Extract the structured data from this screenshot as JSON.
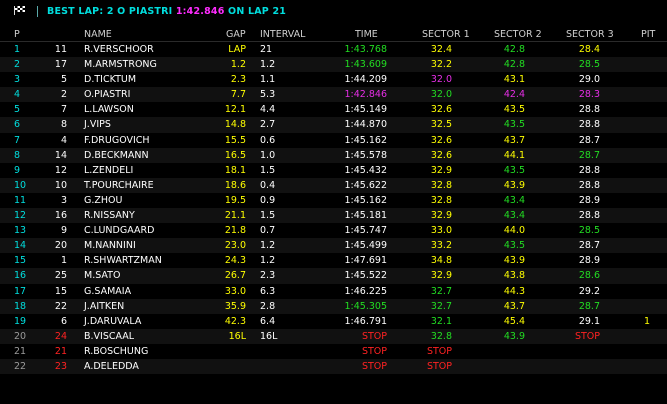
{
  "colors": {
    "cyan": "#00dede",
    "yellow": "#ffff00",
    "green": "#22dd22",
    "purple": "#e52ee5",
    "red": "#ff2222",
    "grey": "#9a9a9a",
    "white": "#ffffff"
  },
  "banner": {
    "prefix": "BEST LAP: 2 O PIASTRI",
    "best_time": "1:42.846",
    "middle": " ON LAP ",
    "lap": "21"
  },
  "headers": {
    "pos": "P",
    "name": "NAME",
    "gap": "GAP",
    "interval": "INTERVAL",
    "time": "TIME",
    "s1": "SECTOR 1",
    "s2": "SECTOR 2",
    "s3": "SECTOR 3",
    "pit": "PIT"
  },
  "rows": [
    {
      "pos": "1",
      "num": "11",
      "name": "R.VERSCHOOR",
      "gap": "LAP",
      "int": "21",
      "time": "1:43.768",
      "s1": "32.4",
      "s2": "42.8",
      "s3": "28.4",
      "pit": "",
      "pc": "cyan",
      "nc": "white",
      "gc": "yellow",
      "ic": "white",
      "tc": "green",
      "s1c": "yellow",
      "s2c": "green",
      "s3c": "yellow",
      "ptc": "white"
    },
    {
      "pos": "2",
      "num": "17",
      "name": "M.ARMSTRONG",
      "gap": "1.2",
      "int": "1.2",
      "time": "1:43.609",
      "s1": "32.2",
      "s2": "42.8",
      "s3": "28.5",
      "pit": "",
      "pc": "cyan",
      "nc": "white",
      "gc": "yellow",
      "ic": "white",
      "tc": "green",
      "s1c": "yellow",
      "s2c": "green",
      "s3c": "green",
      "ptc": "white"
    },
    {
      "pos": "3",
      "num": "5",
      "name": "D.TICKTUM",
      "gap": "2.3",
      "int": "1.1",
      "time": "1:44.209",
      "s1": "32.0",
      "s2": "43.1",
      "s3": "29.0",
      "pit": "",
      "pc": "cyan",
      "nc": "white",
      "gc": "yellow",
      "ic": "white",
      "tc": "white",
      "s1c": "purple",
      "s2c": "yellow",
      "s3c": "white",
      "ptc": "white"
    },
    {
      "pos": "4",
      "num": "2",
      "name": "O.PIASTRI",
      "gap": "7.7",
      "int": "5.3",
      "time": "1:42.846",
      "s1": "32.0",
      "s2": "42.4",
      "s3": "28.3",
      "pit": "",
      "pc": "cyan",
      "nc": "white",
      "gc": "yellow",
      "ic": "white",
      "tc": "purple",
      "s1c": "green",
      "s2c": "purple",
      "s3c": "purple",
      "ptc": "white"
    },
    {
      "pos": "5",
      "num": "7",
      "name": "L.LAWSON",
      "gap": "12.1",
      "int": "4.4",
      "time": "1:45.149",
      "s1": "32.6",
      "s2": "43.5",
      "s3": "28.8",
      "pit": "",
      "pc": "cyan",
      "nc": "white",
      "gc": "yellow",
      "ic": "white",
      "tc": "white",
      "s1c": "yellow",
      "s2c": "yellow",
      "s3c": "white",
      "ptc": "white"
    },
    {
      "pos": "6",
      "num": "8",
      "name": "J.VIPS",
      "gap": "14.8",
      "int": "2.7",
      "time": "1:44.870",
      "s1": "32.5",
      "s2": "43.5",
      "s3": "28.8",
      "pit": "",
      "pc": "cyan",
      "nc": "white",
      "gc": "yellow",
      "ic": "white",
      "tc": "white",
      "s1c": "yellow",
      "s2c": "green",
      "s3c": "white",
      "ptc": "white"
    },
    {
      "pos": "7",
      "num": "4",
      "name": "F.DRUGOVICH",
      "gap": "15.5",
      "int": "0.6",
      "time": "1:45.162",
      "s1": "32.6",
      "s2": "43.7",
      "s3": "28.7",
      "pit": "",
      "pc": "cyan",
      "nc": "white",
      "gc": "yellow",
      "ic": "white",
      "tc": "white",
      "s1c": "yellow",
      "s2c": "yellow",
      "s3c": "white",
      "ptc": "white"
    },
    {
      "pos": "8",
      "num": "14",
      "name": "D.BECKMANN",
      "gap": "16.5",
      "int": "1.0",
      "time": "1:45.578",
      "s1": "32.6",
      "s2": "44.1",
      "s3": "28.7",
      "pit": "",
      "pc": "cyan",
      "nc": "white",
      "gc": "yellow",
      "ic": "white",
      "tc": "white",
      "s1c": "yellow",
      "s2c": "yellow",
      "s3c": "green",
      "ptc": "white"
    },
    {
      "pos": "9",
      "num": "12",
      "name": "L.ZENDELI",
      "gap": "18.1",
      "int": "1.5",
      "time": "1:45.432",
      "s1": "32.9",
      "s2": "43.5",
      "s3": "28.8",
      "pit": "",
      "pc": "cyan",
      "nc": "white",
      "gc": "yellow",
      "ic": "white",
      "tc": "white",
      "s1c": "yellow",
      "s2c": "green",
      "s3c": "white",
      "ptc": "white"
    },
    {
      "pos": "10",
      "num": "10",
      "name": "T.POURCHAIRE",
      "gap": "18.6",
      "int": "0.4",
      "time": "1:45.622",
      "s1": "32.8",
      "s2": "43.9",
      "s3": "28.8",
      "pit": "",
      "pc": "cyan",
      "nc": "white",
      "gc": "yellow",
      "ic": "white",
      "tc": "white",
      "s1c": "yellow",
      "s2c": "yellow",
      "s3c": "white",
      "ptc": "white"
    },
    {
      "pos": "11",
      "num": "3",
      "name": "G.ZHOU",
      "gap": "19.5",
      "int": "0.9",
      "time": "1:45.162",
      "s1": "32.8",
      "s2": "43.4",
      "s3": "28.9",
      "pit": "",
      "pc": "cyan",
      "nc": "white",
      "gc": "yellow",
      "ic": "white",
      "tc": "white",
      "s1c": "yellow",
      "s2c": "green",
      "s3c": "white",
      "ptc": "white"
    },
    {
      "pos": "12",
      "num": "16",
      "name": "R.NISSANY",
      "gap": "21.1",
      "int": "1.5",
      "time": "1:45.181",
      "s1": "32.9",
      "s2": "43.4",
      "s3": "28.8",
      "pit": "",
      "pc": "cyan",
      "nc": "white",
      "gc": "yellow",
      "ic": "white",
      "tc": "white",
      "s1c": "yellow",
      "s2c": "green",
      "s3c": "white",
      "ptc": "white"
    },
    {
      "pos": "13",
      "num": "9",
      "name": "C.LUNDGAARD",
      "gap": "21.8",
      "int": "0.7",
      "time": "1:45.747",
      "s1": "33.0",
      "s2": "44.0",
      "s3": "28.5",
      "pit": "",
      "pc": "cyan",
      "nc": "white",
      "gc": "yellow",
      "ic": "white",
      "tc": "white",
      "s1c": "yellow",
      "s2c": "yellow",
      "s3c": "green",
      "ptc": "white"
    },
    {
      "pos": "14",
      "num": "20",
      "name": "M.NANNINI",
      "gap": "23.0",
      "int": "1.2",
      "time": "1:45.499",
      "s1": "33.2",
      "s2": "43.5",
      "s3": "28.7",
      "pit": "",
      "pc": "cyan",
      "nc": "white",
      "gc": "yellow",
      "ic": "white",
      "tc": "white",
      "s1c": "yellow",
      "s2c": "green",
      "s3c": "white",
      "ptc": "white"
    },
    {
      "pos": "15",
      "num": "1",
      "name": "R.SHWARTZMAN",
      "gap": "24.3",
      "int": "1.2",
      "time": "1:47.691",
      "s1": "34.8",
      "s2": "43.9",
      "s3": "28.9",
      "pit": "",
      "pc": "cyan",
      "nc": "white",
      "gc": "yellow",
      "ic": "white",
      "tc": "white",
      "s1c": "yellow",
      "s2c": "yellow",
      "s3c": "white",
      "ptc": "white"
    },
    {
      "pos": "16",
      "num": "25",
      "name": "M.SATO",
      "gap": "26.7",
      "int": "2.3",
      "time": "1:45.522",
      "s1": "32.9",
      "s2": "43.8",
      "s3": "28.6",
      "pit": "",
      "pc": "cyan",
      "nc": "white",
      "gc": "yellow",
      "ic": "white",
      "tc": "white",
      "s1c": "yellow",
      "s2c": "yellow",
      "s3c": "green",
      "ptc": "white"
    },
    {
      "pos": "17",
      "num": "15",
      "name": "G.SAMAIA",
      "gap": "33.0",
      "int": "6.3",
      "time": "1:46.225",
      "s1": "32.7",
      "s2": "44.3",
      "s3": "29.2",
      "pit": "",
      "pc": "cyan",
      "nc": "white",
      "gc": "yellow",
      "ic": "white",
      "tc": "white",
      "s1c": "green",
      "s2c": "yellow",
      "s3c": "white",
      "ptc": "white"
    },
    {
      "pos": "18",
      "num": "22",
      "name": "J.AITKEN",
      "gap": "35.9",
      "int": "2.8",
      "time": "1:45.305",
      "s1": "32.7",
      "s2": "43.7",
      "s3": "28.7",
      "pit": "",
      "pc": "cyan",
      "nc": "white",
      "gc": "yellow",
      "ic": "white",
      "tc": "green",
      "s1c": "green",
      "s2c": "yellow",
      "s3c": "green",
      "ptc": "white"
    },
    {
      "pos": "19",
      "num": "6",
      "name": "J.DARUVALA",
      "gap": "42.3",
      "int": "6.4",
      "time": "1:46.791",
      "s1": "32.1",
      "s2": "45.4",
      "s3": "29.1",
      "pit": "1",
      "pc": "cyan",
      "nc": "white",
      "gc": "yellow",
      "ic": "white",
      "tc": "white",
      "s1c": "green",
      "s2c": "yellow",
      "s3c": "white",
      "ptc": "yellow"
    },
    {
      "pos": "20",
      "num": "24",
      "name": "B.VISCAAL",
      "gap": "16L",
      "int": "16L",
      "time": "STOP",
      "s1": "32.8",
      "s2": "43.9",
      "s3": "STOP",
      "pit": "",
      "pc": "grey",
      "nc": "red",
      "gc": "yellow",
      "ic": "white",
      "tc": "red",
      "s1c": "green",
      "s2c": "green",
      "s3c": "red",
      "ptc": "white"
    },
    {
      "pos": "21",
      "num": "21",
      "name": "R.BOSCHUNG",
      "gap": "",
      "int": "",
      "time": "STOP",
      "s1": "STOP",
      "s2": "",
      "s3": "",
      "pit": "",
      "pc": "grey",
      "nc": "red",
      "gc": "yellow",
      "ic": "white",
      "tc": "red",
      "s1c": "red",
      "s2c": "white",
      "s3c": "white",
      "ptc": "white"
    },
    {
      "pos": "22",
      "num": "23",
      "name": "A.DELEDDA",
      "gap": "",
      "int": "",
      "time": "STOP",
      "s1": "STOP",
      "s2": "",
      "s3": "",
      "pit": "",
      "pc": "grey",
      "nc": "red",
      "gc": "yellow",
      "ic": "white",
      "tc": "red",
      "s1c": "red",
      "s2c": "white",
      "s3c": "white",
      "ptc": "white"
    }
  ]
}
